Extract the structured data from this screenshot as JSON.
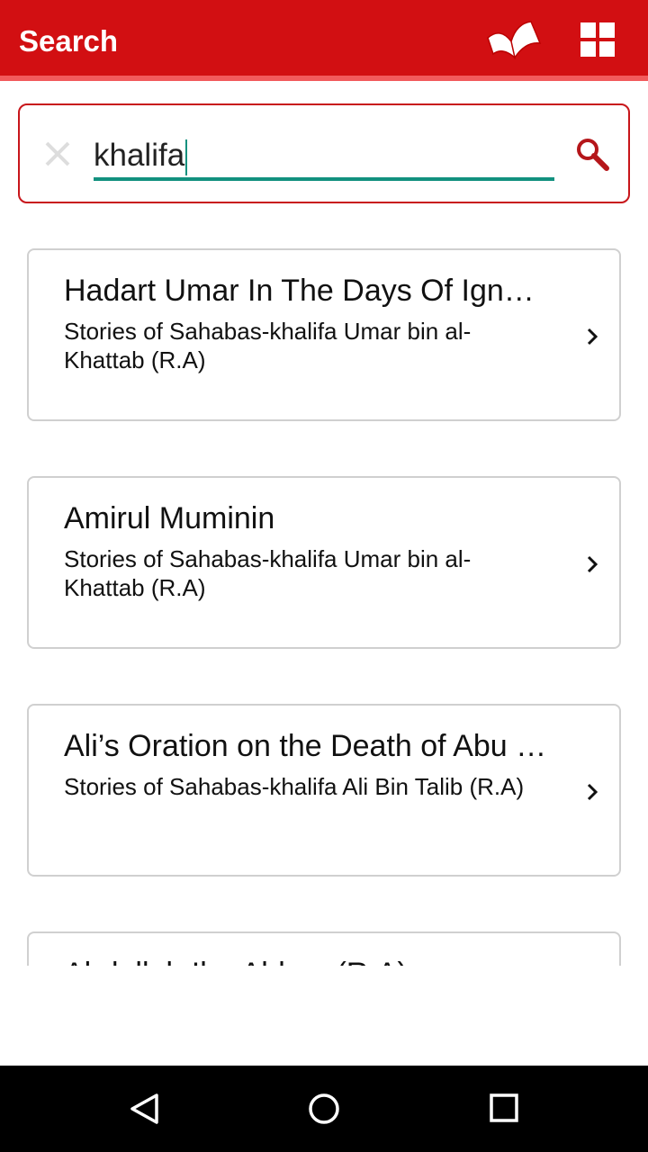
{
  "appbar": {
    "title": "Search",
    "icons": [
      "open-book-icon",
      "grid-menu-icon"
    ],
    "color": "#d20f12"
  },
  "search": {
    "value": "khalifa",
    "accent": "#12917f"
  },
  "results": [
    {
      "title": "Hadart Umar In The Days Of Ignorance",
      "subtitle": "Stories of Sahabas-khalifa Umar bin al-Khattab (R.A)"
    },
    {
      "title": "Amirul Muminin",
      "subtitle": "Stories of Sahabas-khalifa Umar bin al-Khattab (R.A)"
    },
    {
      "title": "Ali’s Oration on the Death of Abu Bakr",
      "subtitle": "Stories of Sahabas-khalifa Ali Bin Talib (R.A)"
    },
    {
      "title": "Abdullah Ibn Abbas (R.A)",
      "subtitle": ""
    }
  ],
  "navbar": {
    "icons": [
      "back-icon",
      "home-icon",
      "recents-icon"
    ]
  }
}
